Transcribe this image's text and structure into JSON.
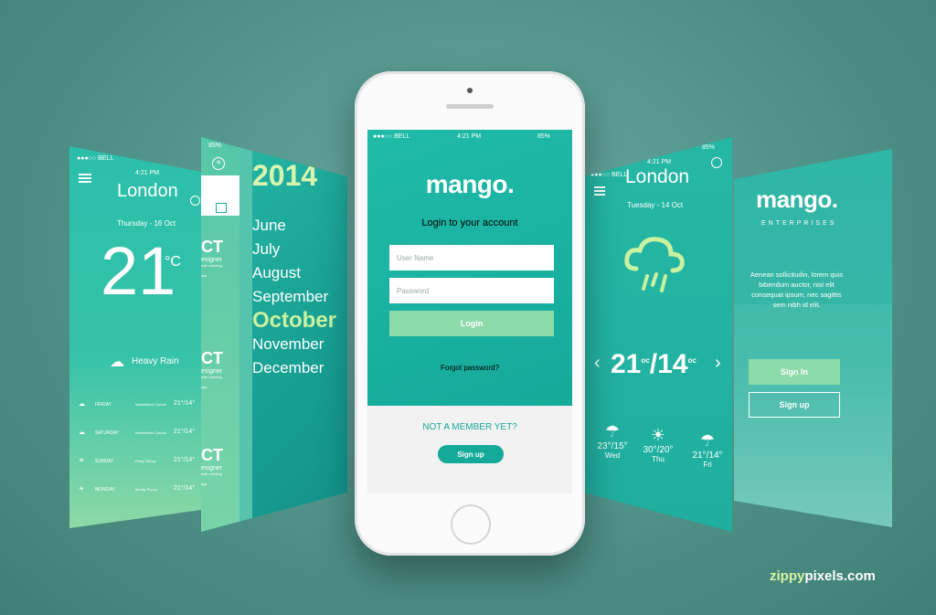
{
  "weather_left": {
    "status": "●●●○○ BELL",
    "time": "4:21 PM",
    "city": "London",
    "date": "Thursday - 16 Oct",
    "temp": "21",
    "unit": "°C",
    "condition": "Heavy Rain",
    "forecast": [
      {
        "day": "FRIDAY",
        "desc": "Intermittent Clouds",
        "temp": "21°/14°"
      },
      {
        "day": "SATURDAY",
        "desc": "Intermittent Clouds",
        "temp": "21°/14°"
      },
      {
        "day": "SUNDAY",
        "desc": "Partly Sunny",
        "temp": "21°/14°"
      },
      {
        "day": "MONDAY",
        "desc": "Mostly Sunny",
        "temp": "21°/14°"
      }
    ]
  },
  "calendar": {
    "battery": "85%",
    "year": "2014",
    "months": [
      "June",
      "July",
      "August",
      "September",
      "October",
      "November",
      "December"
    ],
    "selected_month": "October",
    "events": [
      {
        "code": "CT",
        "role": "esigner",
        "note": "edin meeting",
        "meta": "ays"
      },
      {
        "code": "CT",
        "role": "esigner",
        "note": "edin meeting",
        "meta": "ays"
      },
      {
        "code": "CT",
        "role": "esigner",
        "note": "edin meeting",
        "meta": "ays"
      }
    ]
  },
  "login_screen": {
    "carrier": "●●●○○ BELL",
    "time": "4:21 PM",
    "battery": "85%",
    "logo": "mango.",
    "heading": "Login to your account",
    "username_placeholder": "User Name",
    "password_placeholder": "Password",
    "login_button": "Login",
    "forgot_link": "Forgot password?",
    "not_member": "NOT A MEMBER YET?",
    "signup_button": "Sign up"
  },
  "weather_right": {
    "carrier": "●●●○○ BELL",
    "time": "4:21 PM",
    "battery": "85%",
    "city": "London",
    "date": "Tuesday - 14 Oct",
    "high": "21",
    "low": "14",
    "unit": "oc",
    "forecast": [
      {
        "day": "Wed",
        "temp": "23°/15°"
      },
      {
        "day": "Thu",
        "temp": "30°/20°"
      },
      {
        "day": "Fri",
        "temp": "21°/14°"
      }
    ]
  },
  "enterprise": {
    "logo": "mango.",
    "subtitle": "ENTERPRISES",
    "body": "Aenean sollicitudin, lorem quis bibendum auctor, nisi elit consequat ipsum, nec sagittis sem nibh id elit.",
    "signin_button": "Sign In",
    "signup_button": "Sign up"
  },
  "watermark": {
    "brand_a": "zippy",
    "brand_b": "pixels.com"
  },
  "colors": {
    "background": "#4f9288",
    "teal": "#15a99a",
    "light_green": "#8ddba9",
    "highlight": "#c9f2a0"
  }
}
